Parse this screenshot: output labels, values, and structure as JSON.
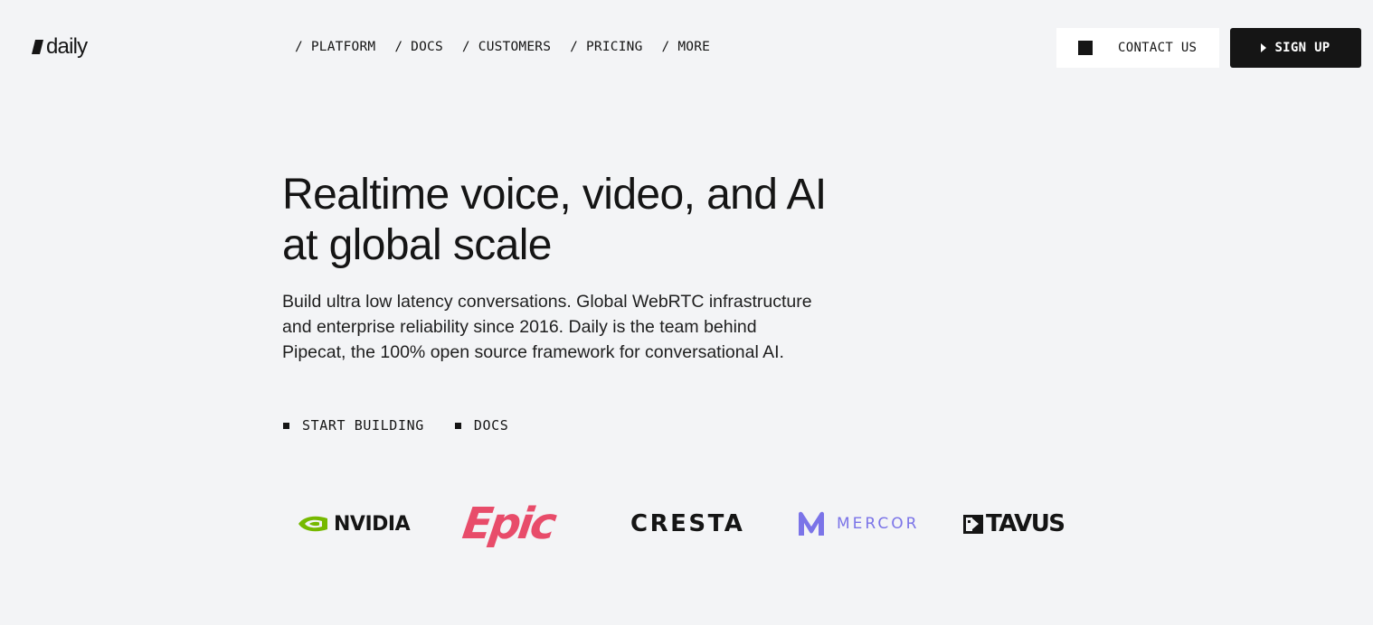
{
  "header": {
    "logo_text": "daily",
    "nav": [
      "/ PLATFORM",
      "/ DOCS",
      "/ CUSTOMERS",
      "/ PRICING",
      "/ MORE"
    ],
    "contact_label": "CONTACT US",
    "signup_label": "SIGN UP"
  },
  "hero": {
    "title": "Realtime voice, video, and AI at global scale",
    "subtitle": "Build ultra low latency conversations. Global WebRTC infrastructure and enterprise reliability since 2016. Daily is the team behind Pipecat, the 100% open source framework for conversational AI.",
    "cta_primary": "START BUILDING",
    "cta_secondary": "DOCS"
  },
  "customers": {
    "logos": [
      {
        "name": "NVIDIA",
        "icon": "nvidia-eye-icon",
        "color": "#76b900"
      },
      {
        "name": "Epic",
        "color": "#e84c6a"
      },
      {
        "name": "CRESTA",
        "color": "#151515"
      },
      {
        "name": "MERCOR",
        "icon": "mercor-m-icon",
        "color": "#7b74e8"
      },
      {
        "name": "TAVUS",
        "icon": "tavus-face-icon",
        "color": "#151515"
      }
    ]
  },
  "colors": {
    "background": "#f3f4f6",
    "text": "#151515",
    "button_dark": "#151515",
    "button_light": "#ffffff"
  }
}
